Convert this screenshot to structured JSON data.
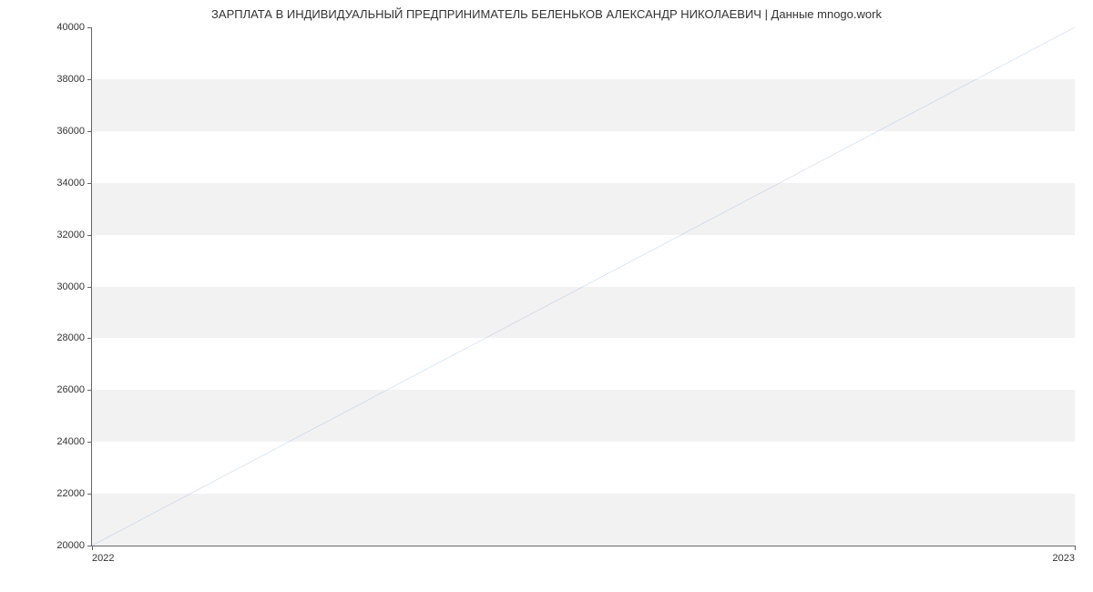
{
  "chart_data": {
    "type": "line",
    "title": "ЗАРПЛАТА В ИНДИВИДУАЛЬНЫЙ ПРЕДПРИНИМАТЕЛЬ БЕЛЕНЬКОВ АЛЕКСАНДР НИКОЛАЕВИЧ | Данные mnogo.work",
    "xlabel": "",
    "ylabel": "",
    "x": [
      "2022",
      "2023"
    ],
    "values": [
      20000,
      40000
    ],
    "ylim": [
      20000,
      40000
    ],
    "y_ticks": [
      20000,
      22000,
      24000,
      26000,
      28000,
      30000,
      32000,
      34000,
      36000,
      38000,
      40000
    ],
    "x_ticks": [
      "2022",
      "2023"
    ],
    "line_color": "#6699dd",
    "band_color": "#f2f2f2"
  }
}
